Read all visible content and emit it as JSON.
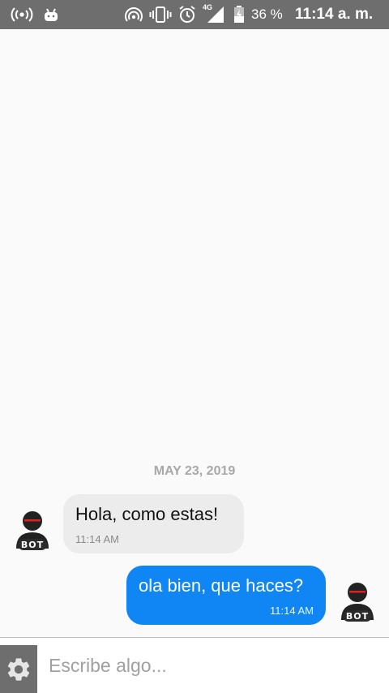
{
  "status_bar": {
    "battery_percent": "36 %",
    "network_type": "4G",
    "time": "11:14 a. m.",
    "icons": [
      "hotspot-icon",
      "android-icon",
      "cast-icon",
      "vibrate-icon",
      "alarm-icon",
      "signal-icon",
      "battery-icon"
    ]
  },
  "chat": {
    "date_separator": "MAY 23, 2019",
    "messages": [
      {
        "sender": "bot",
        "direction": "incoming",
        "text": "Hola, como estas!",
        "time": "11:14 AM"
      },
      {
        "sender": "user",
        "direction": "outgoing",
        "text": "ola bien, que haces?",
        "time": "11:14 AM"
      }
    ],
    "avatar_label": "BOT"
  },
  "composer": {
    "placeholder": "Escribe algo...",
    "value": ""
  },
  "colors": {
    "status_bar": "#6e6e6e",
    "outgoing_bubble": "#1086f5",
    "incoming_bubble": "#ececec",
    "background": "#fafafa"
  }
}
